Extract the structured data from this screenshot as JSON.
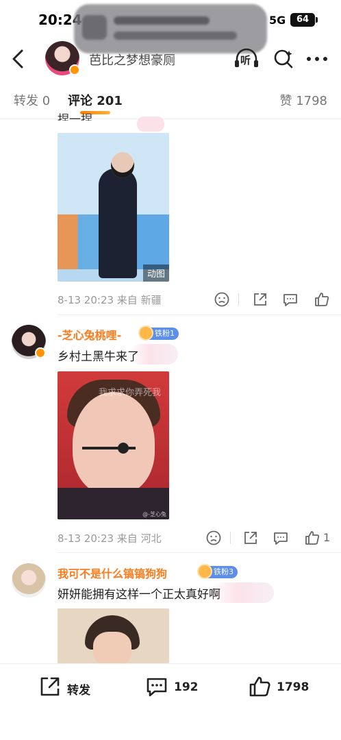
{
  "status_bar": {
    "time": "20:24",
    "network": "5G",
    "battery": "64"
  },
  "nav": {
    "title": "芭比之梦想豪厕",
    "listen_label": "听"
  },
  "tabs": {
    "repost": "转发 0",
    "comments": "评论 201",
    "likes": "赞 1798"
  },
  "comments": [
    {
      "partial_text": "捏一捏",
      "media_label": "动图",
      "meta": "8-13 20:23 来自 新疆",
      "like_count": ""
    },
    {
      "username": "-芝心兔桃哩-",
      "fan_badge": "铁粉1",
      "text": "乡村土黑牛来了",
      "media_caption": "我求求你弄死我",
      "media_watermark": "@-芝心兔",
      "meta": "8-13 20:23 来自 河北",
      "like_count": "1"
    },
    {
      "username": "我可不是什么镐镐狗狗",
      "fan_badge": "铁粉3",
      "text": "妍妍能拥有这样一个正太真好啊"
    }
  ],
  "bottom_bar": {
    "repost_label": "转发",
    "comment_count": "192",
    "like_count": "1798"
  },
  "colors": {
    "accent": "#ff8200",
    "username": "#ff7a1a",
    "fan_badge": "#5d8fe8",
    "verified": "#ff9500"
  },
  "icons": [
    "back-icon",
    "listen-icon",
    "search-icon",
    "more-icon",
    "dislike-icon",
    "share-icon",
    "comment-icon",
    "like-icon",
    "repost-icon"
  ]
}
